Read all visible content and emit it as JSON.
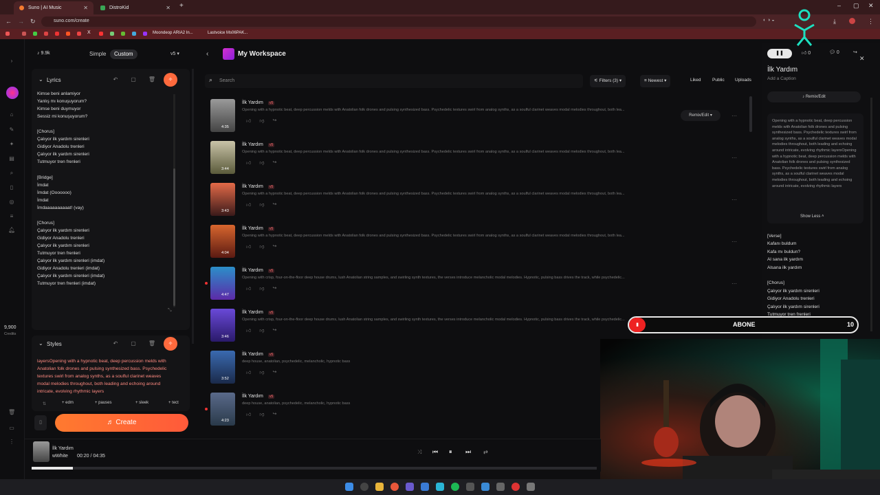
{
  "browser": {
    "tabs": [
      {
        "label": "Suno | AI Music"
      },
      {
        "label": "DistroKid"
      }
    ],
    "url": "suno.com/create",
    "bookmarks": [
      {
        "label": "Moondeop ARIA2 In..."
      },
      {
        "label": "Lastvoice Ms06PAK..."
      }
    ]
  },
  "left": {
    "credits_top": "9.9k",
    "mode_simple": "Simple",
    "mode_custom": "Custom",
    "version": "v5",
    "lyrics_header": "Lyrics",
    "lyrics_text": "Kimse beni anlamiyor\nYanlış mı konuşuyorum?\nKimse beni duymuyor\nSessiz mi konuşuyorum?\n\n[Chorus]\nÇalıyor ilk yardım sirenleri\nGidiyor Anadolu trenleri\nÇalıyor ilk yardım sirenleri\nTutmuyor tren frenleri\n\n[Bridge]\nİmdat\nİmdat (Ooooooo)\nİmdat\nİmdaaaaaaaaaat! (vay)\n\n[Chorus]\nÇalıyor ilk yardım sirenleri\nGidiyor Anadolu trenleri\nÇalıyor ilk yardım sirenleri\nTutmuyor tren frenleri\nÇalıyor ilk yardım sirenleri (imdat)\nGidiyor Anadolu trenleri (imdat)\nÇalıyor ilk yardım sirenleri (imdat)\nTutmuyor tren frenleri (imdat)",
    "credits_side": "9,900",
    "credits_label": "Credits",
    "styles_header": "Styles",
    "styles_text": "layersOpening with a hypnotic beat, deep percussion melds with Anatolian folk drones and pulsing synthesized bass. Psychedelic textures swirl from analog synths, as a soulful clarinet weaves modal melodies throughout, both leading and echoing around intricate, evolving rhythmic layers",
    "tags": [
      "+ edm",
      "+ pauses",
      "+ sleek",
      "+ tect"
    ],
    "create_label": "Create"
  },
  "workspace": {
    "title": "My Workspace",
    "search_placeholder": "Search",
    "filters": "Filters (3)",
    "sort": "Newest",
    "liked": "Liked",
    "public": "Public",
    "uploads": "Uploads",
    "remix": "Remix/Edit",
    "songs": [
      {
        "title": "İlk Yardım",
        "badge": "v5",
        "duration": "4:35",
        "desc": "Opening with a hypnotic beat, deep percussion melds with Anatolian folk drones and pulsing synthesized bass. Psychedelic textures swirl from analog synths, as a soulful clarinet weaves modal melodies throughout, both lea..."
      },
      {
        "title": "İlk Yardım",
        "badge": "v5",
        "duration": "3:44",
        "desc": "Opening with a hypnotic beat, deep percussion melds with Anatolian folk drones and pulsing synthesized bass. Psychedelic textures swirl from analog synths, as a soulful clarinet weaves modal melodies throughout, both lea..."
      },
      {
        "title": "İlk Yardım",
        "badge": "v5",
        "duration": "3:43",
        "desc": "Opening with a hypnotic beat, deep percussion melds with Anatolian folk drones and pulsing synthesized bass. Psychedelic textures swirl from analog synths, as a soulful clarinet weaves modal melodies throughout, both lea..."
      },
      {
        "title": "İlk Yardım",
        "badge": "v5",
        "duration": "4:04",
        "desc": "Opening with a hypnotic beat, deep percussion melds with Anatolian folk drones and pulsing synthesized bass. Psychedelic textures swirl from analog synths, as a soulful clarinet weaves modal melodies throughout, both lea..."
      },
      {
        "title": "İlk Yardım",
        "badge": "v5",
        "duration": "4:47",
        "desc": "Opening with crisp, four-on-the-floor deep house drums, lush Anatolian string samples, and swirling synth textures, the verses introduce melancholic modal melodies. Hypnotic, pulsing bass drives the track, while psychedelic..."
      },
      {
        "title": "İlk Yardım",
        "badge": "v5",
        "duration": "3:46",
        "desc": "Opening with crisp, four-on-the-floor deep house drums, lush Anatolian string samples, and swirling synth textures, the verses introduce melancholic modal melodies. Hypnotic, pulsing bass drives the track, while psychedelic..."
      },
      {
        "title": "İlk Yardım",
        "badge": "v5",
        "duration": "3:52",
        "desc": "deep house, anatolian, psychedelic, melancholic, hypnotic bass"
      },
      {
        "title": "İlk Yardım",
        "badge": "v5",
        "duration": "4:23",
        "desc": "deep house, anatolian, psychedelic, melancholic, hypnotic bass"
      }
    ]
  },
  "right": {
    "likes": "0",
    "comments": "0",
    "title": "İlk Yardım",
    "caption": "Add a Caption",
    "remix": "Remix/Edit",
    "desc": "Opening with a hypnotic beat, deep percussion melds with Anatolian folk drones and pulsing synthesized bass. Psychedelic textures swirl from analog synths, as a soulful clarinet weaves modal melodies throughout, both leading and echoing around intricate, evolving rhythmic layersOpening with a hypnotic beat, deep percussion melds with Anatolian folk drones and pulsing synthesized bass. Psychedelic textures swirl from analog synths, as a soulful clarinet weaves modal melodies throughout, both leading and echoing around intricate, evolving rhythmic layers",
    "show_less": "Show Less",
    "lyrics": "[Verse]\nKafanı buldum\nKafa mı buldun?\nAl sana ilk yardım\nAlsana ilk yardım\n\n[Chorus]\nÇalıyor ilk yardım sirenleri\nGidiyor Anadolu trenleri\nÇalıyor ilk yardım sirenleri\nTutmuyor tren frenleri\n\n[Verse 2]"
  },
  "overlay": {
    "abone": "ABONE",
    "count": "10"
  },
  "player": {
    "title": "İlk Yardım",
    "artist": "wWhite",
    "time": "00:20 / 04:35",
    "progress": 0.0727
  }
}
